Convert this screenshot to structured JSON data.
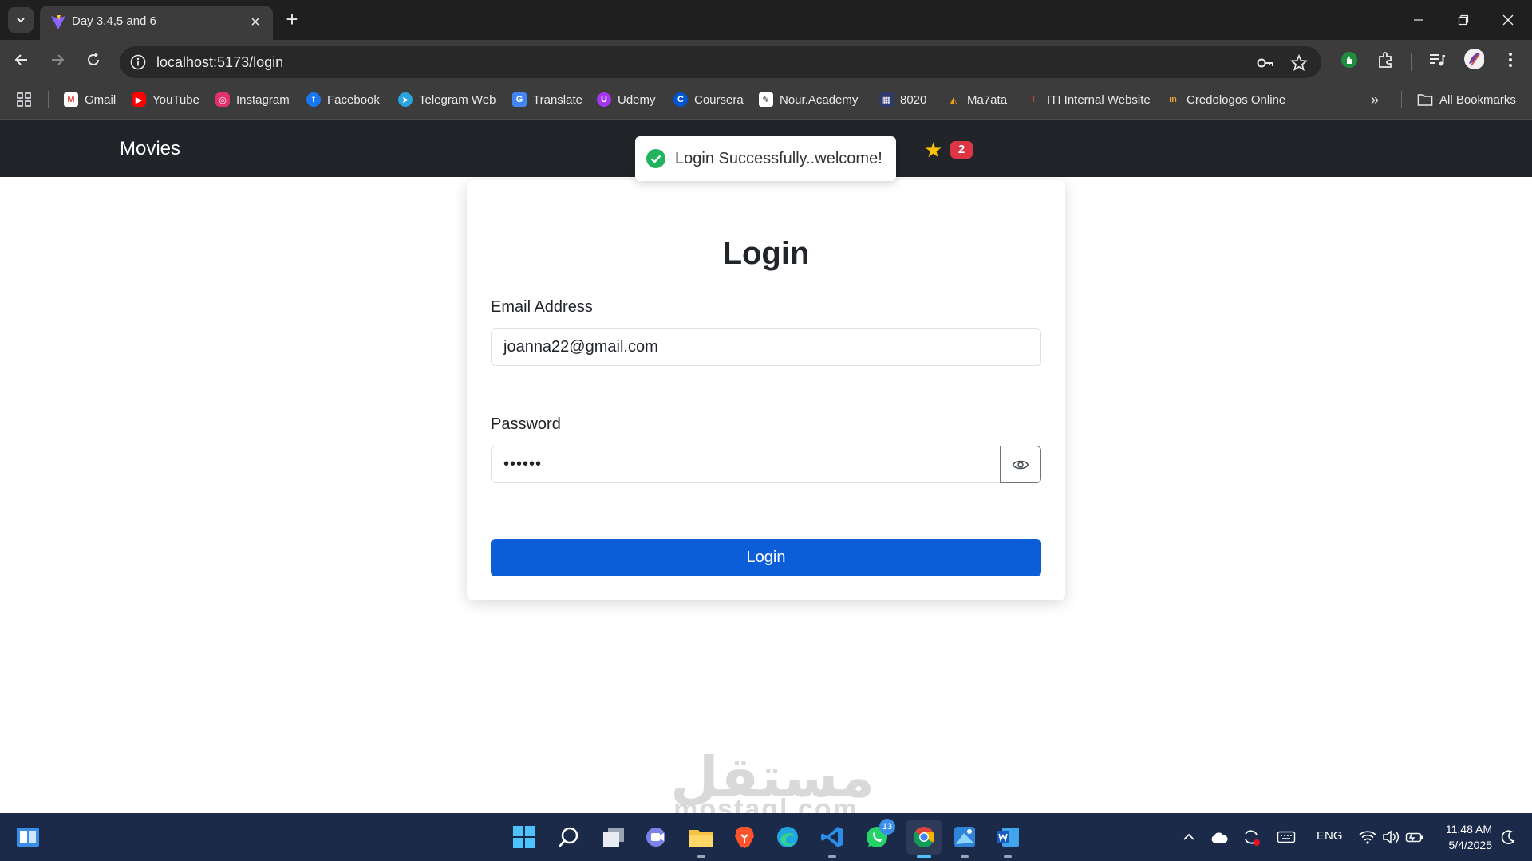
{
  "browser": {
    "tab_title": "Day 3,4,5 and 6",
    "url": "localhost:5173/login",
    "bookmarks": [
      {
        "label": "Gmail",
        "icon": "gmail-icon",
        "color": "#ea4335"
      },
      {
        "label": "YouTube",
        "icon": "youtube-icon",
        "color": "#ff0000"
      },
      {
        "label": "Instagram",
        "icon": "instagram-icon",
        "color": "#e1306c"
      },
      {
        "label": "Facebook",
        "icon": "facebook-icon",
        "color": "#1877f2"
      },
      {
        "label": "Telegram Web",
        "icon": "telegram-icon",
        "color": "#2aa3df"
      },
      {
        "label": "Translate",
        "icon": "translate-icon",
        "color": "#4285f4"
      },
      {
        "label": "Udemy",
        "icon": "udemy-icon",
        "color": "#a435f0"
      },
      {
        "label": "Coursera",
        "icon": "coursera-icon",
        "color": "#0056d2"
      },
      {
        "label": "Nour.Academy",
        "icon": "nour-academy-icon",
        "color": "#ffffff"
      },
      {
        "label": "8020",
        "icon": "8020-icon",
        "color": "#2d3a6b"
      },
      {
        "label": "Ma7ata",
        "icon": "ma7ata-icon",
        "color": "#f39c12"
      },
      {
        "label": "ITI Internal Website",
        "icon": "iti-icon",
        "color": "#c0392b"
      },
      {
        "label": "Credologos Online",
        "icon": "credologos-icon",
        "color": "#f1a33a"
      }
    ],
    "all_bookmarks": "All Bookmarks"
  },
  "app": {
    "brand": "Movies",
    "favorites_count": "2"
  },
  "toast": {
    "message": "Login Successfully..welcome!"
  },
  "login": {
    "title": "Login",
    "email_label": "Email Address",
    "email_value": "joanna22@gmail.com",
    "password_label": "Password",
    "password_value": "••••••",
    "submit_label": "Login"
  },
  "watermark": {
    "arabic": "مستقل",
    "latin": "mostaql.com"
  },
  "taskbar": {
    "whatsapp_badge": "13",
    "language": "ENG",
    "time": "11:48 AM",
    "date": "5/4/2025"
  },
  "colors": {
    "navbar": "#212529",
    "primary_button": "#0b5ed7",
    "badge": "#dc3545",
    "star": "#ffc107",
    "success": "#22b35e"
  }
}
